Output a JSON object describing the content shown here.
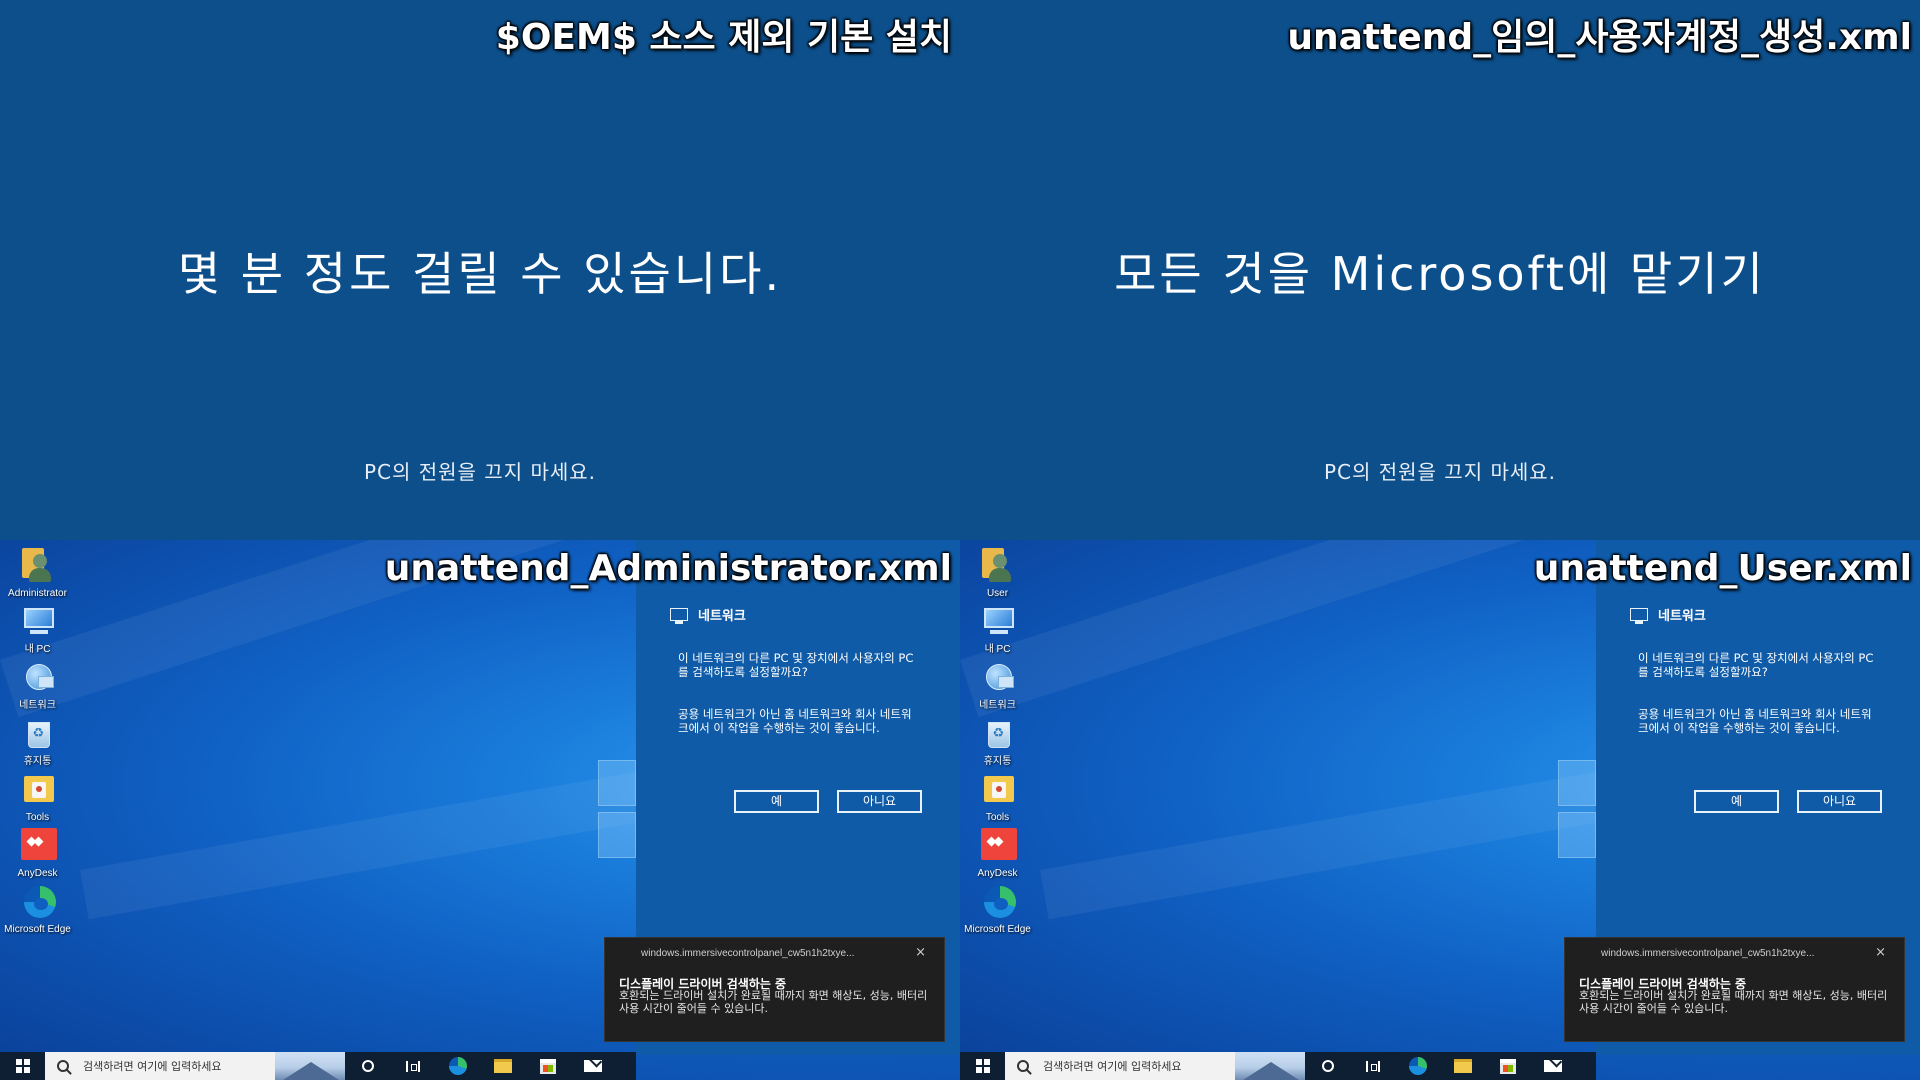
{
  "quadrants": {
    "top_left": {
      "caption": "$OEM$ 소스 제외 기본 설치",
      "main_text": "몇 분 정도 걸릴 수 있습니다.",
      "sub_text": "PC의 전원을 끄지 마세요."
    },
    "top_right": {
      "caption": "unattend_임의_사용자계정_생성.xml",
      "main_text": "모든 것을 Microsoft에 맡기기",
      "sub_text": "PC의 전원을 끄지 마세요."
    },
    "bottom_left": {
      "caption": "unattend_Administrator.xml",
      "desktop_icons": [
        {
          "label": "Administrator",
          "icon": "user-folder-icon"
        },
        {
          "label": "내 PC",
          "icon": "this-pc-icon"
        },
        {
          "label": "네트워크",
          "icon": "network-icon"
        },
        {
          "label": "휴지통",
          "icon": "recycle-bin-icon"
        },
        {
          "label": "Tools",
          "icon": "tools-folder-icon"
        },
        {
          "label": "AnyDesk",
          "icon": "anydesk-icon"
        },
        {
          "label": "Microsoft Edge",
          "icon": "edge-icon"
        }
      ]
    },
    "bottom_right": {
      "caption": "unattend_User.xml",
      "desktop_icons": [
        {
          "label": "User",
          "icon": "user-folder-icon"
        },
        {
          "label": "내 PC",
          "icon": "this-pc-icon"
        },
        {
          "label": "네트워크",
          "icon": "network-icon"
        },
        {
          "label": "휴지통",
          "icon": "recycle-bin-icon"
        },
        {
          "label": "Tools",
          "icon": "tools-folder-icon"
        },
        {
          "label": "AnyDesk",
          "icon": "anydesk-icon"
        },
        {
          "label": "Microsoft Edge",
          "icon": "edge-icon"
        }
      ]
    }
  },
  "network_panel": {
    "title": "네트워크",
    "question": "이 네트워크의 다른 PC 및 장치에서 사용자의 PC를 검색하도록 설정할까요?",
    "description": "공용 네트워크가 아닌 홈 네트워크와 회사 네트워크에서 이 작업을 수행하는 것이 좋습니다.",
    "yes_label": "예",
    "no_label": "아니요"
  },
  "toast": {
    "app": "windows.immersivecontrolpanel_cw5n1h2txye...",
    "title": "디스플레이 드라이버 검색하는 중",
    "body": "호환되는 드라이버 설치가 완료될 때까지 화면 해상도, 성능, 배터리 사용 시간이 줄어들 수 있습니다.",
    "close": "×"
  },
  "taskbar": {
    "search_placeholder": "검색하려면 여기에 입력하세요",
    "icons": [
      "start-icon",
      "search-icon",
      "cortana-icon",
      "task-view-icon",
      "edge-icon",
      "file-explorer-icon",
      "store-icon",
      "mail-icon"
    ]
  },
  "colors": {
    "oobe_background": "#0d4f8b",
    "panel_background": "#0f5ba8",
    "taskbar": "#0f1f33"
  }
}
